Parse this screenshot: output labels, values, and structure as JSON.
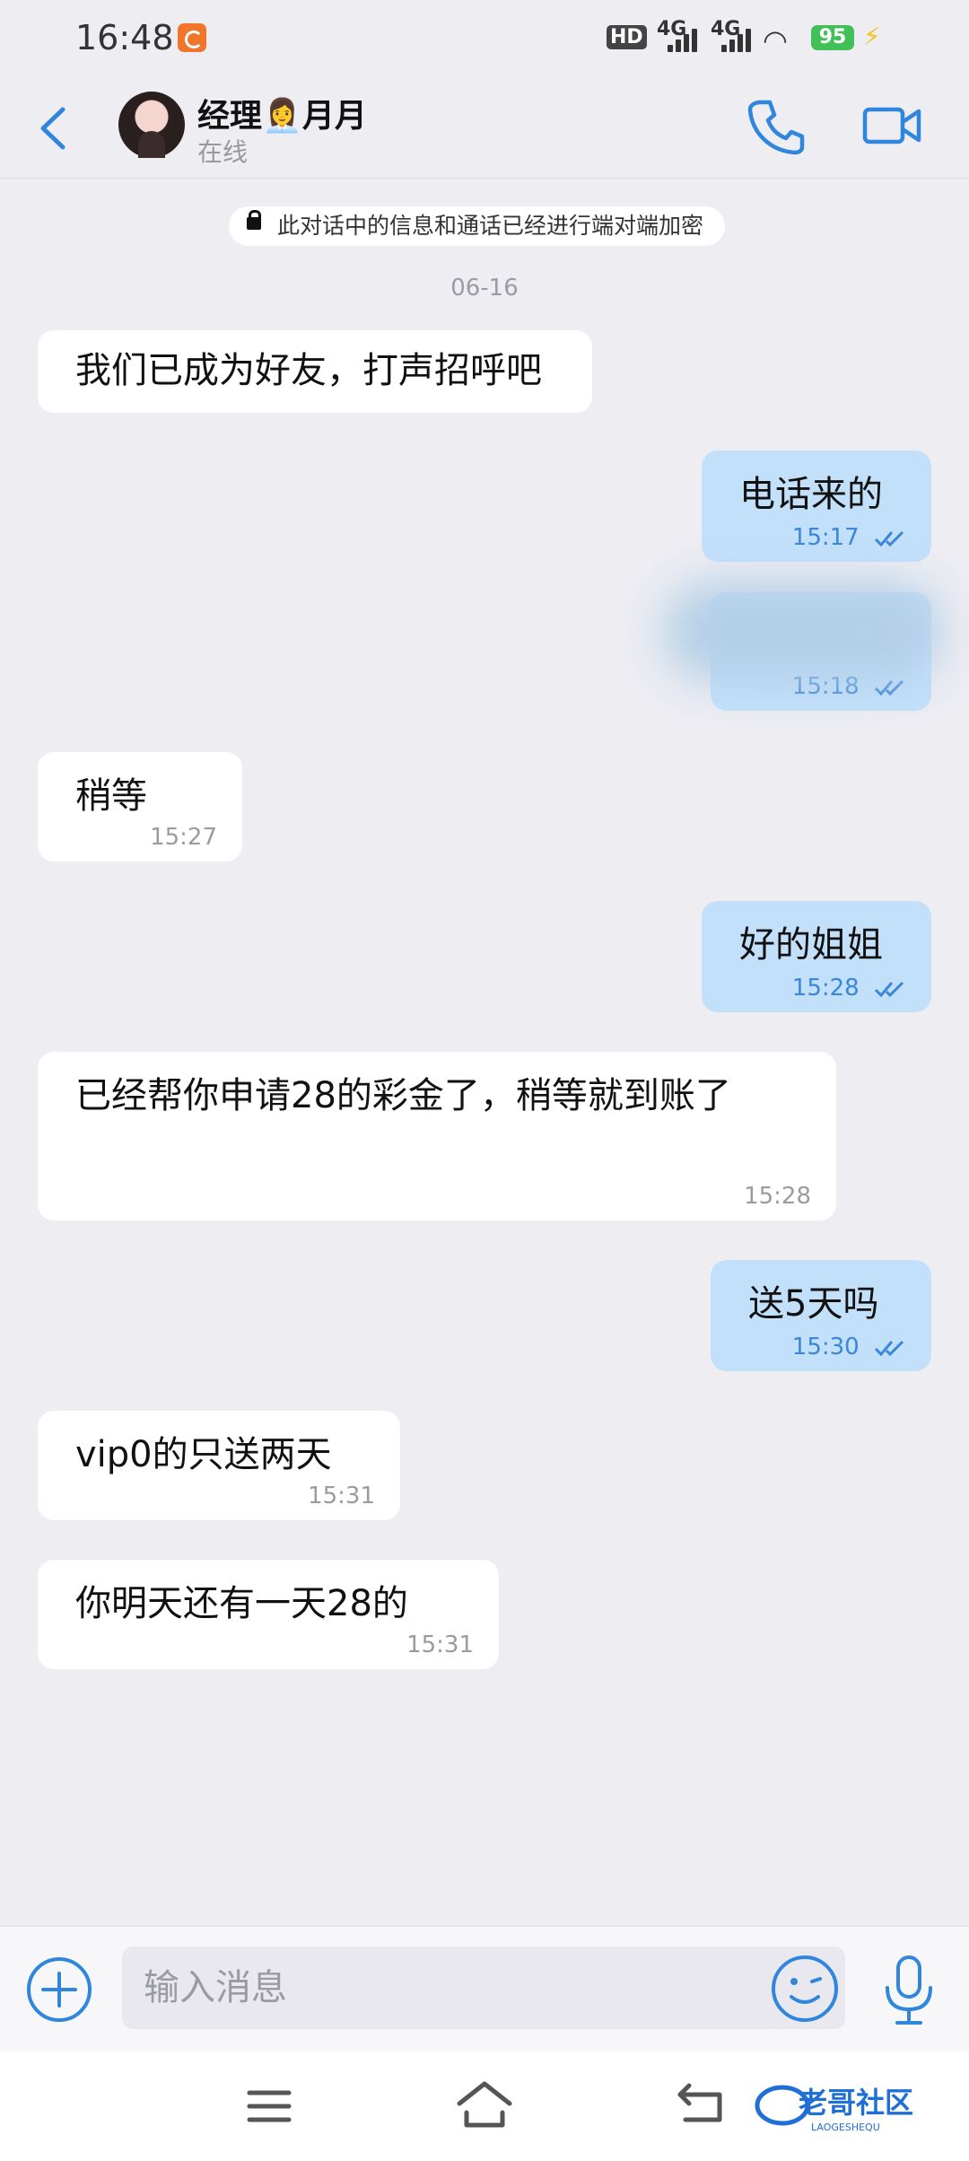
{
  "status_bar": {
    "time": "16:48",
    "hd_badge": "HD",
    "network_1": "4G",
    "network_2": "4G",
    "battery": "95",
    "icons": [
      "app-notification-icon",
      "hd-icon",
      "signal-icon",
      "wifi-icon",
      "battery-icon",
      "charging-icon"
    ]
  },
  "header": {
    "contact_name": "经理👩‍💼月月",
    "status": "在线",
    "icons": [
      "back-icon",
      "avatar",
      "phone-icon",
      "video-icon"
    ]
  },
  "encryption_notice": "此对话中的信息和通话已经进行端对端加密",
  "date_divider": "06-16",
  "messages": [
    {
      "dir": "in",
      "text": "我们已成为好友，打声招呼吧",
      "time": ""
    },
    {
      "dir": "out",
      "text": "电话来的",
      "time": "15:17",
      "read": true
    },
    {
      "dir": "out",
      "text": "",
      "time": "15:18",
      "read": true,
      "blurred": true
    },
    {
      "dir": "in",
      "text": "稍等",
      "time": "15:27"
    },
    {
      "dir": "out",
      "text": "好的姐姐",
      "time": "15:28",
      "read": true
    },
    {
      "dir": "in",
      "text": "已经帮你申请28的彩金了，稍等就到账了",
      "time": "15:28"
    },
    {
      "dir": "out",
      "text": "送5天吗",
      "time": "15:30",
      "read": true
    },
    {
      "dir": "in",
      "text": "vip0的只送两天",
      "time": "15:31"
    },
    {
      "dir": "in",
      "text": "你明天还有一天28的",
      "time": "15:31"
    }
  ],
  "input_bar": {
    "placeholder": "输入消息",
    "icons": [
      "plus-icon",
      "emoji-icon",
      "mic-icon"
    ]
  },
  "nav_bar": {
    "icons": [
      "menu-icon",
      "home-icon",
      "back-nav-icon"
    ],
    "watermark": "老哥社区",
    "watermark_sub": "LAOGESHEQU"
  },
  "colors": {
    "background": "#ededf2",
    "incoming_bubble": "#ffffff",
    "outgoing_bubble": "#c3e0fb",
    "accent": "#3a86d8"
  }
}
